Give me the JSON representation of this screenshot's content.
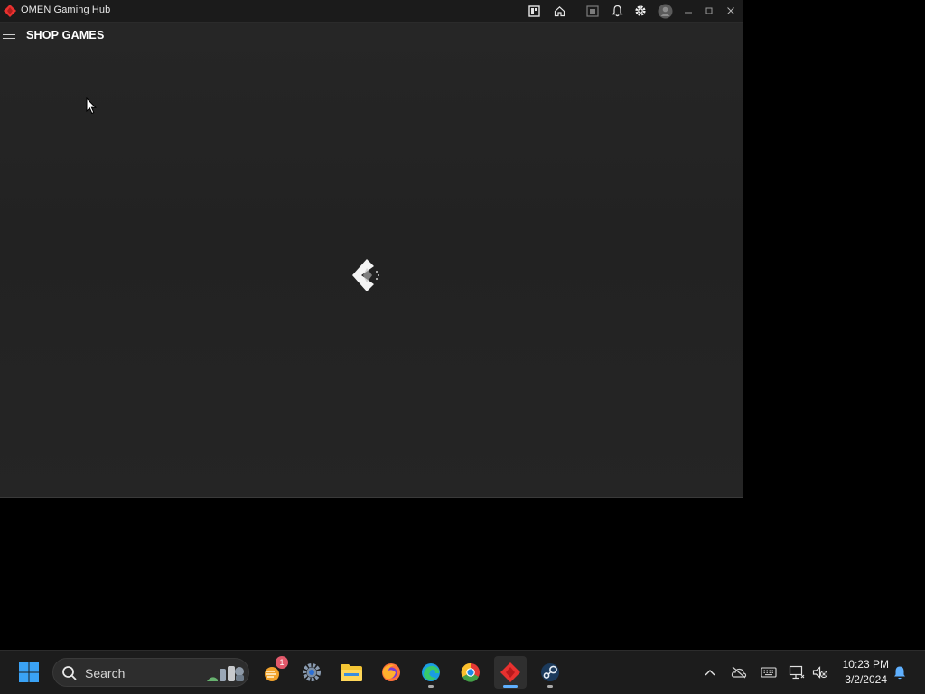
{
  "window": {
    "title": "OMEN Gaming Hub",
    "accent_color": "#e8312f",
    "titlebar_icons": [
      "library-icon",
      "home-icon",
      "screenshot-icon",
      "bell-icon",
      "gear-icon",
      "user-avatar-icon",
      "minimize-icon",
      "maximize-icon",
      "close-icon"
    ]
  },
  "page": {
    "heading": "SHOP GAMES",
    "menu_icon": "hamburger-menu-icon",
    "state": "loading"
  },
  "taskbar": {
    "search": {
      "label": "Search"
    },
    "apps": [
      {
        "name": "Widgets",
        "icon": "widgets-icon",
        "badge": "1"
      },
      {
        "name": "Settings",
        "icon": "settings-gear-icon"
      },
      {
        "name": "File Explorer",
        "icon": "folder-icon"
      },
      {
        "name": "Firefox",
        "icon": "firefox-icon"
      },
      {
        "name": "Microsoft Edge",
        "icon": "edge-icon"
      },
      {
        "name": "Google Chrome",
        "icon": "chrome-icon"
      },
      {
        "name": "OMEN Gaming Hub",
        "icon": "omen-icon",
        "active": true
      },
      {
        "name": "Steam",
        "icon": "steam-icon"
      }
    ],
    "tray": {
      "icons": [
        "chevron-up-icon",
        "cloud-off-icon",
        "keyboard-icon",
        "network-icon",
        "speaker-muted-icon",
        "notification-bell-icon"
      ],
      "time": "10:23 PM",
      "date": "3/2/2024"
    }
  }
}
